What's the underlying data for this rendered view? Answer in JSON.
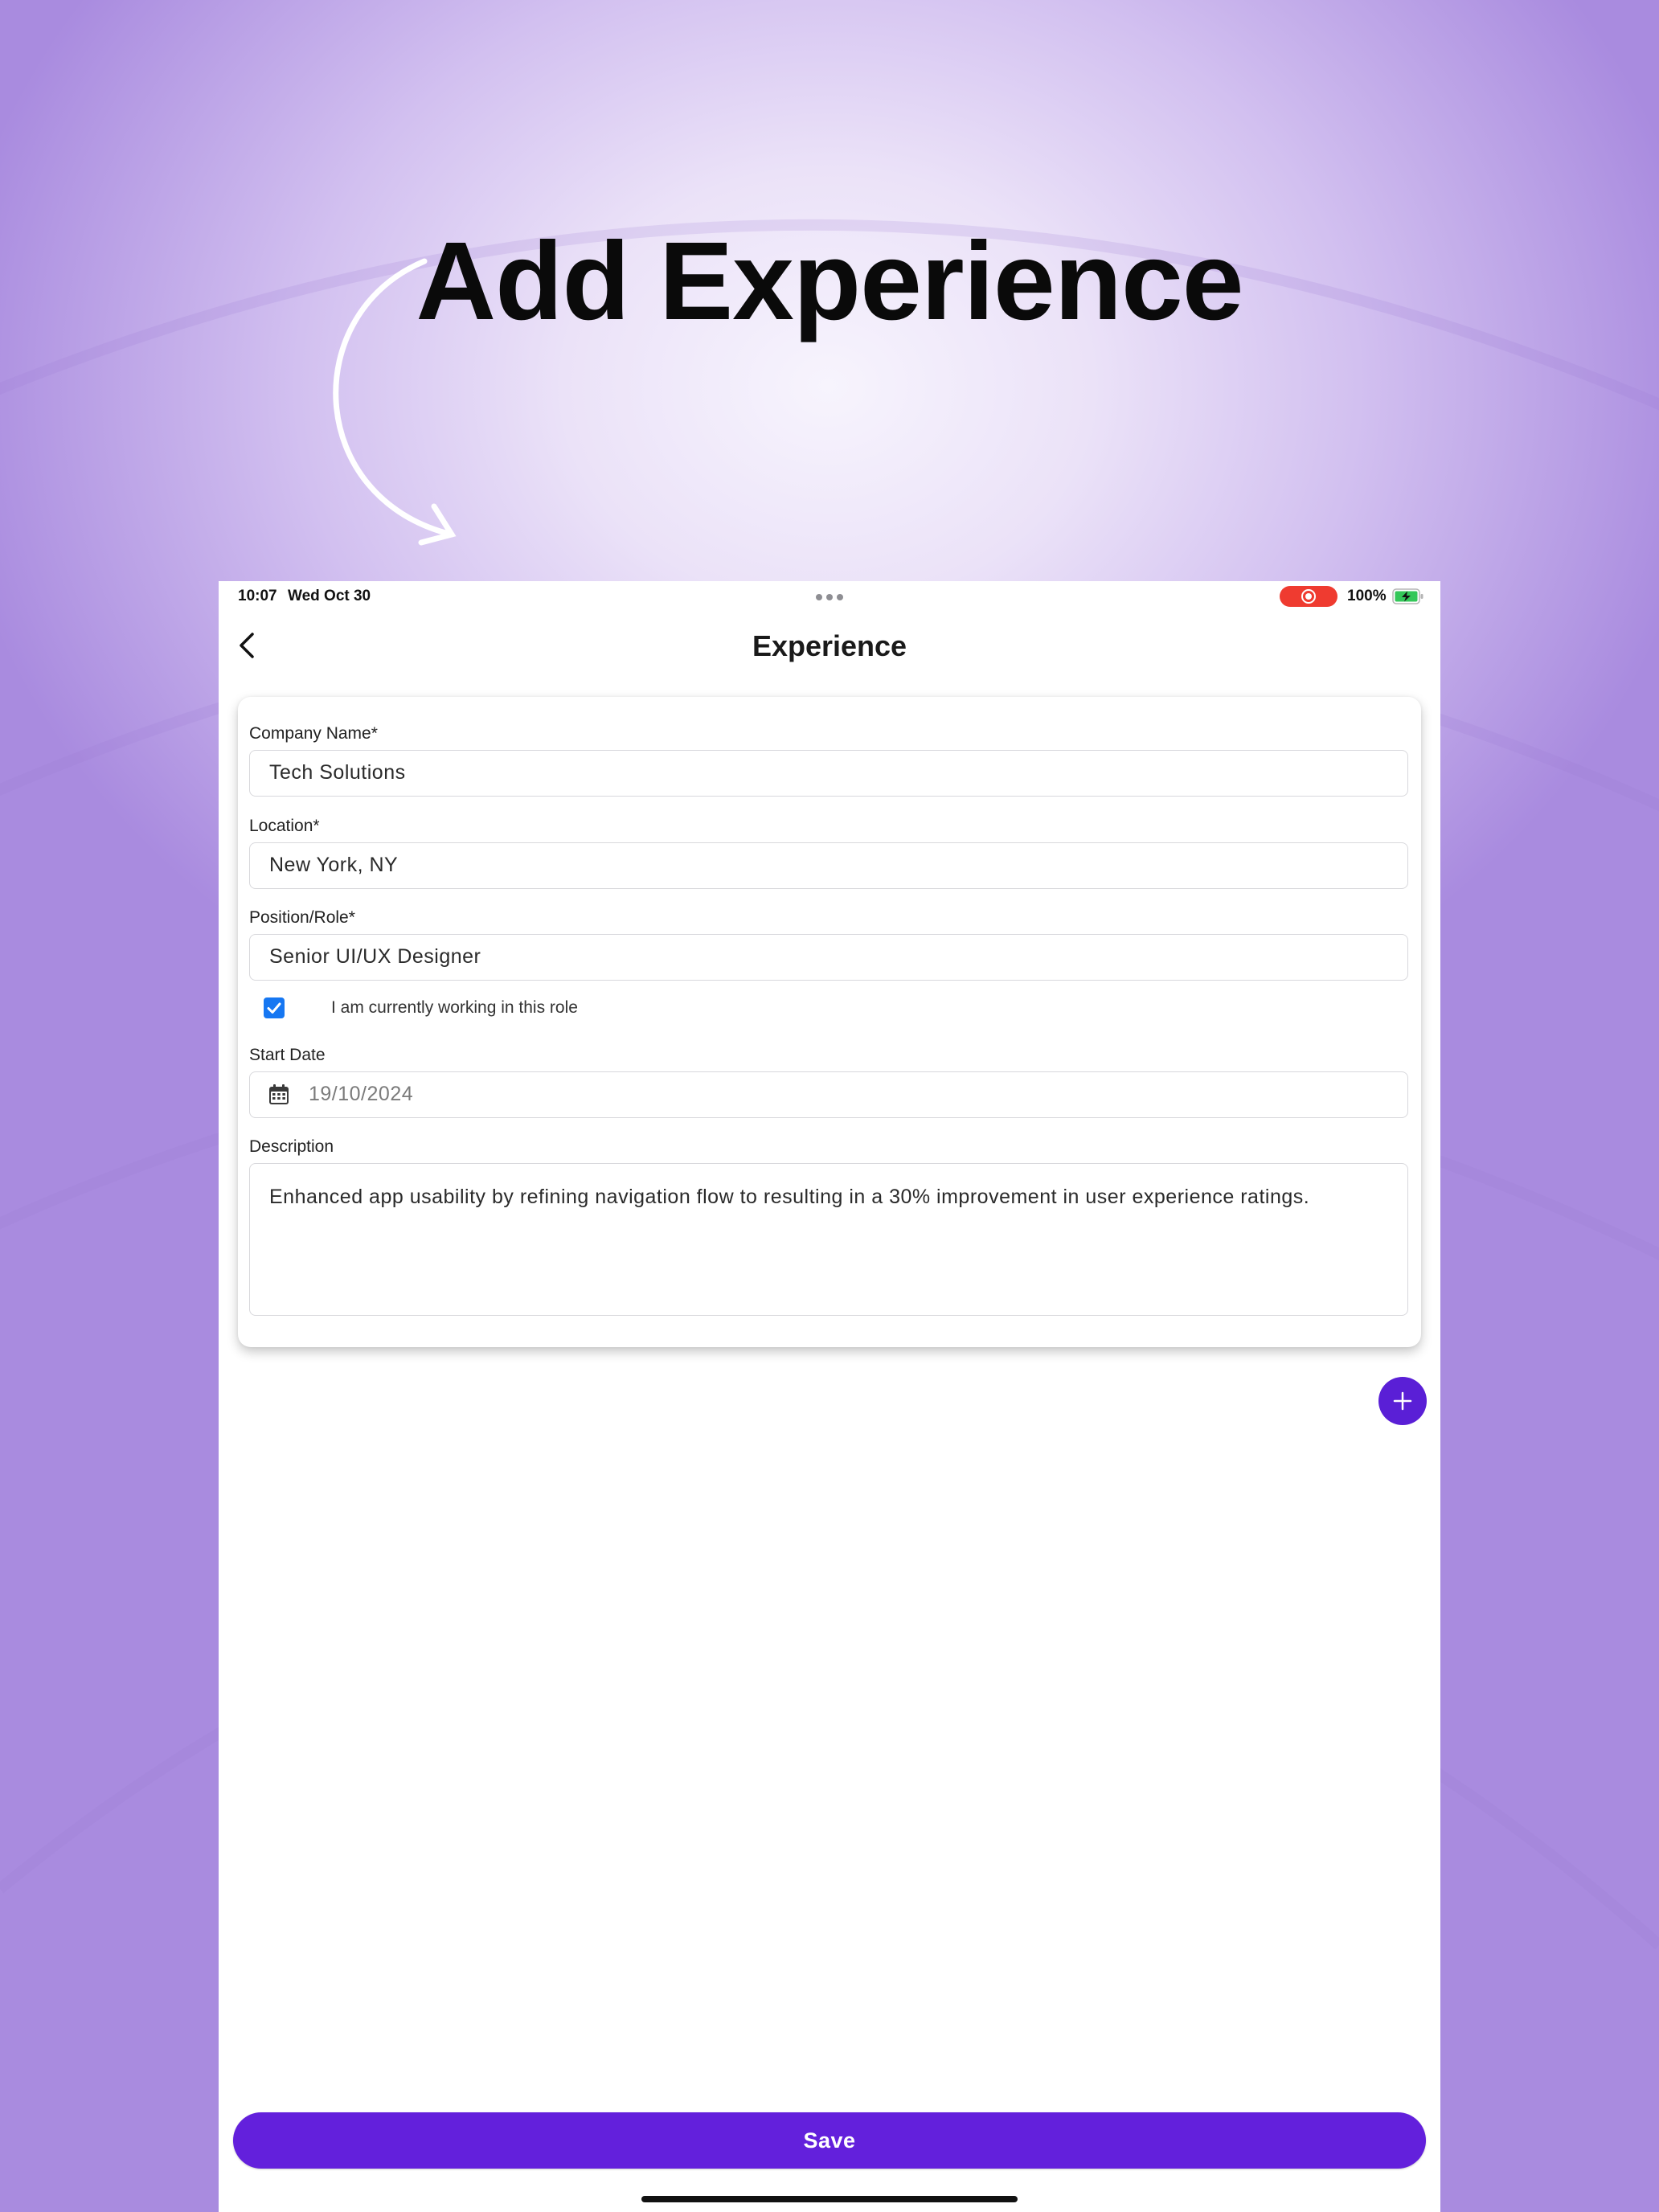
{
  "headline": "Add Experience",
  "status_bar": {
    "time": "10:07",
    "date": "Wed Oct 30",
    "battery": "100%"
  },
  "nav": {
    "title": "Experience",
    "back_icon": "chevron-left-icon"
  },
  "form": {
    "company": {
      "label": "Company Name*",
      "value": "Tech Solutions"
    },
    "location": {
      "label": "Location*",
      "value": "New York, NY"
    },
    "position": {
      "label": "Position/Role*",
      "value": "Senior UI/UX Designer"
    },
    "current_role": {
      "label": "I am currently working in this role",
      "checked": true
    },
    "start_date": {
      "label": "Start Date",
      "value": "19/10/2024",
      "icon": "calendar-icon"
    },
    "description": {
      "label": "Description",
      "value": "Enhanced app usability by refining navigation flow to resulting in a 30% improvement in user experience ratings."
    }
  },
  "add_button_icon": "plus-icon",
  "save_label": "Save",
  "colors": {
    "accent": "#6320DC",
    "checkbox": "#1677F2",
    "record": "#EF3B30",
    "battery": "#34C759"
  }
}
